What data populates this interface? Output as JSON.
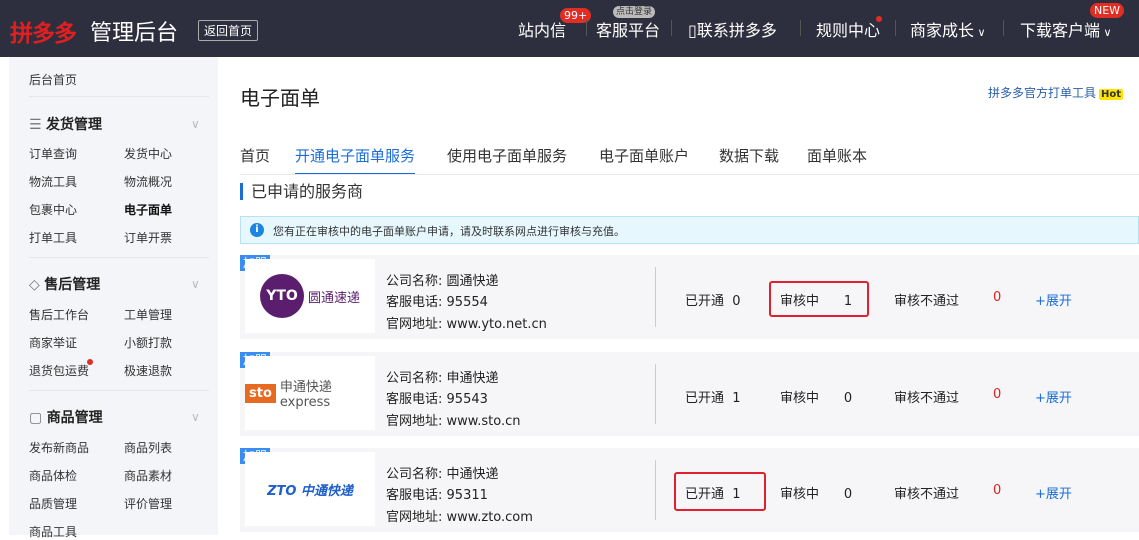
{
  "header": {
    "logo": "拼多多",
    "logo_suffix": "管理后台",
    "back_home": "返回首页",
    "nav": [
      {
        "label": "站内信",
        "badge": "99+"
      },
      {
        "label": "客服平台",
        "badge": "点击登录"
      },
      {
        "label": "联系拼多多"
      },
      {
        "label": "规则中心"
      },
      {
        "label": "商家成长"
      },
      {
        "label": "下载客户端",
        "badge": "NEW"
      }
    ]
  },
  "sidebar": {
    "home": "后台首页",
    "groups": [
      {
        "title": "发货管理",
        "items": [
          "订单查询",
          "发货中心",
          "物流工具",
          "物流概况",
          "包裹中心",
          "电子面单",
          "打单工具",
          "订单开票"
        ]
      },
      {
        "title": "售后管理",
        "items": [
          "售后工作台",
          "工单管理",
          "商家举证",
          "小额打款",
          "退货包运费",
          "极速退款"
        ]
      },
      {
        "title": "商品管理",
        "items": [
          "发布新商品",
          "商品列表",
          "商品体检",
          "商品素材",
          "品质管理",
          "评价管理",
          "商品工具"
        ]
      }
    ]
  },
  "page": {
    "title": "电子面单",
    "top_link": "拼多多官方打单工具",
    "hot": "Hot",
    "tabs": [
      "首页",
      "开通电子面单服务",
      "使用电子面单服务",
      "电子面单账户",
      "数据下载",
      "面单账本"
    ],
    "section": "已申请的服务商",
    "notice": "您有正在审核中的电子面单账户申请，请及时联系网点进行审核与充值。",
    "labels": {
      "tag": "加盟",
      "name": "公司名称:",
      "phone": "客服电话:",
      "site": "官网地址:",
      "opened": "已开通",
      "reviewing": "审核中",
      "rejected": "审核不通过",
      "expand": "+展开"
    },
    "providers": [
      {
        "logo": "圆通速递",
        "name": "圆通快递",
        "phone": "95554",
        "site": "www.yto.net.cn",
        "opened": "0",
        "reviewing": "1",
        "rejected": "0"
      },
      {
        "logo": "申通快递 express",
        "name": "申通快递",
        "phone": "95543",
        "site": "www.sto.cn",
        "opened": "1",
        "reviewing": "0",
        "rejected": "0"
      },
      {
        "logo": "ZTO 中通快递",
        "name": "中通快递",
        "phone": "95311",
        "site": "www.zto.com",
        "opened": "1",
        "reviewing": "0",
        "rejected": "0"
      }
    ]
  }
}
